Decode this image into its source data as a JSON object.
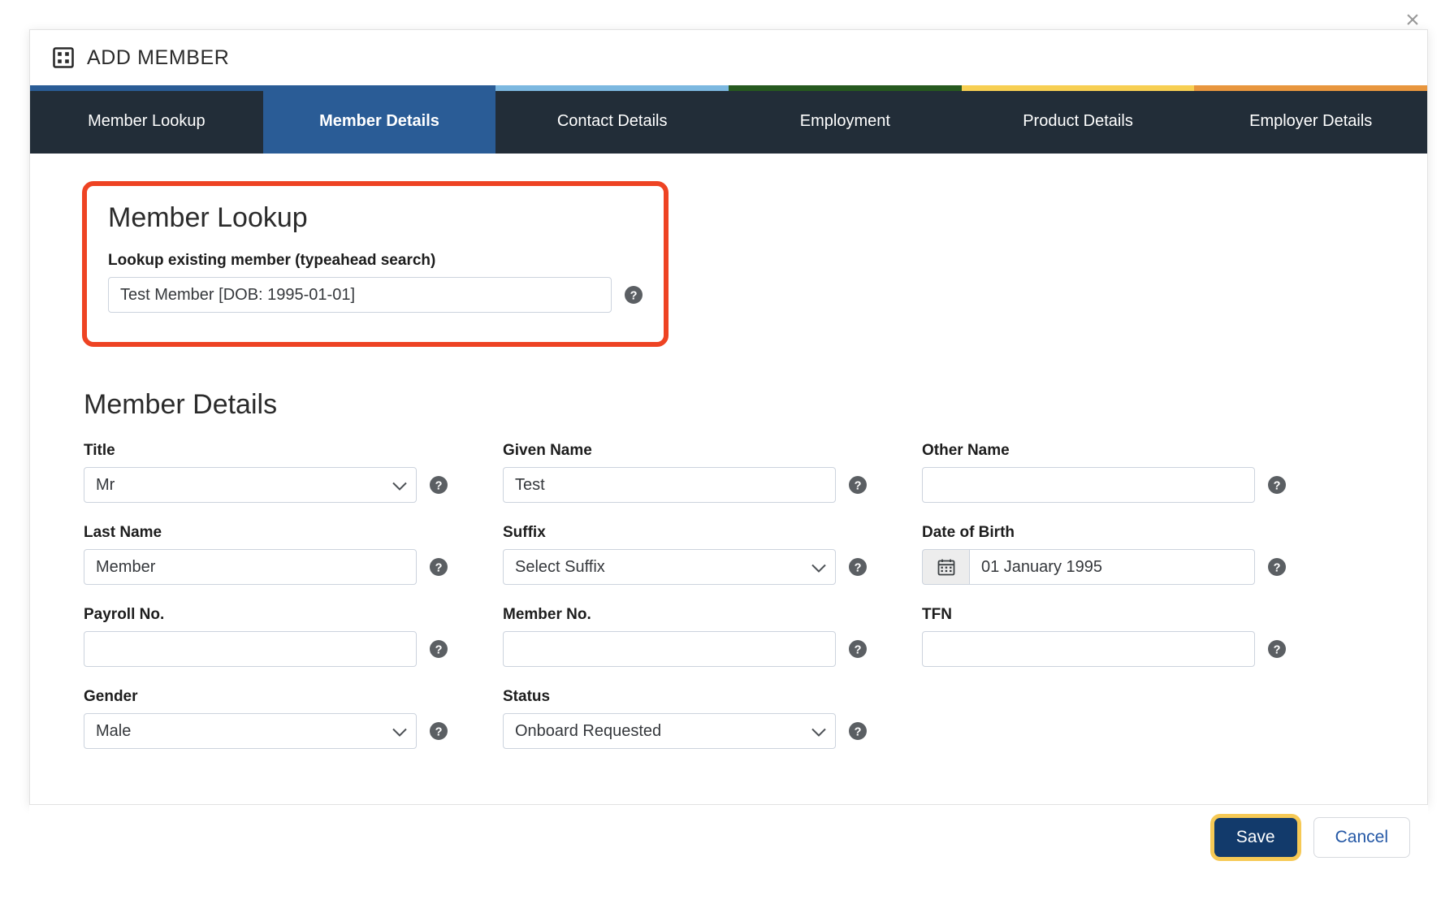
{
  "window": {
    "close_label": "×",
    "title": "ADD MEMBER",
    "title_icon": "grid-icon"
  },
  "tabs": [
    {
      "label": "Member Lookup",
      "active": false,
      "bar_color": "#2a5c96"
    },
    {
      "label": "Member Details",
      "active": true,
      "bar_color": "#2a5c96"
    },
    {
      "label": "Contact Details",
      "active": false,
      "bar_color": "#7cb8e0"
    },
    {
      "label": "Employment",
      "active": false,
      "bar_color": "#26591f"
    },
    {
      "label": "Product Details",
      "active": false,
      "bar_color": "#f7cf52"
    },
    {
      "label": "Employer Details",
      "active": false,
      "bar_color": "#e8963e"
    }
  ],
  "lookup_section": {
    "heading": "Member Lookup",
    "field_label": "Lookup existing member (typeahead search)",
    "field_value": "Test Member [DOB: 1995-01-01]",
    "field_placeholder": "",
    "highlight_color": "#ee4323"
  },
  "details_section": {
    "heading": "Member Details",
    "fields": [
      {
        "label": "Title",
        "type": "select",
        "value": "Mr"
      },
      {
        "label": "Given Name",
        "type": "text",
        "value": "Test"
      },
      {
        "label": "Other Name",
        "type": "text",
        "value": ""
      },
      {
        "label": "Last Name",
        "type": "text",
        "value": "Member"
      },
      {
        "label": "Suffix",
        "type": "select",
        "value": "Select Suffix"
      },
      {
        "label": "Date of Birth",
        "type": "date",
        "value": "01 January 1995"
      },
      {
        "label": "Payroll No.",
        "type": "text",
        "value": ""
      },
      {
        "label": "Member No.",
        "type": "text",
        "value": ""
      },
      {
        "label": "TFN",
        "type": "text",
        "value": ""
      },
      {
        "label": "Gender",
        "type": "select",
        "value": "Male"
      },
      {
        "label": "Status",
        "type": "select",
        "value": "Onboard Requested"
      }
    ]
  },
  "footer": {
    "save_label": "Save",
    "cancel_label": "Cancel",
    "save_focus_ring_color": "#f6c955",
    "save_bg_color": "#123a6b"
  }
}
